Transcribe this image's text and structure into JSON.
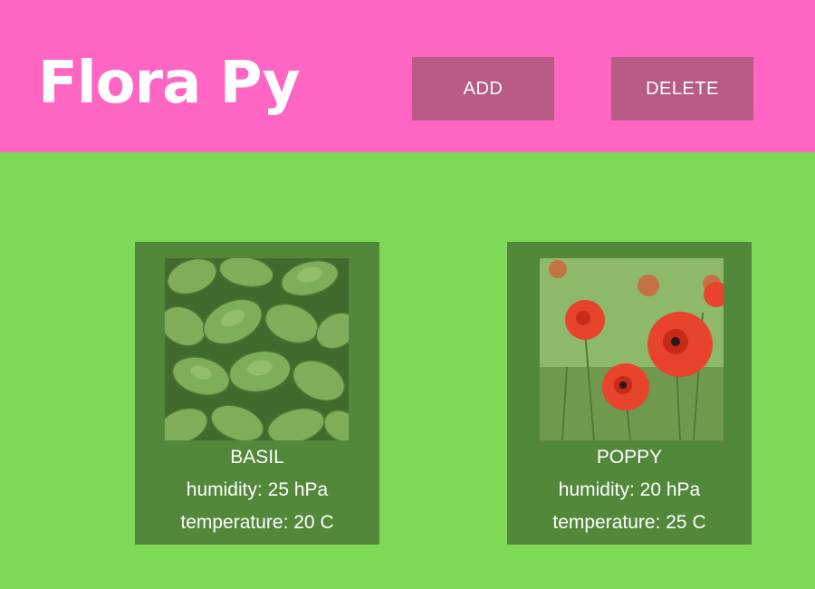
{
  "header": {
    "title": "Flora Py",
    "add_label": "ADD",
    "delete_label": "DELETE"
  },
  "colors": {
    "header_bg": "#ff66c4",
    "button_bg": "#b85c86",
    "page_bg": "#7ed957",
    "card_bg": "#53883b"
  },
  "plants": [
    {
      "name": "BASIL",
      "humidity": "humidity: 25 hPa",
      "temperature": "temperature: 20 C",
      "image": "basil-leaves-photo"
    },
    {
      "name": "POPPY",
      "humidity": "humidity: 20 hPa",
      "temperature": "temperature: 25 C",
      "image": "red-poppies-photo"
    }
  ]
}
